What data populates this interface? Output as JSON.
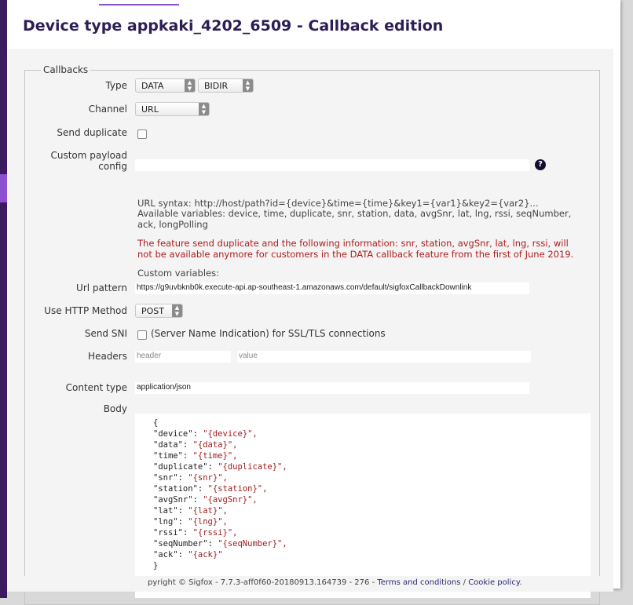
{
  "page": {
    "title": "Device type appkaki_4202_6509 - Callback edition"
  },
  "callbacks": {
    "legend": "Callbacks",
    "type_label": "Type",
    "type_value": "DATA",
    "direction_value": "BIDIR",
    "channel_label": "Channel",
    "channel_value": "URL",
    "send_duplicate_label": "Send duplicate",
    "custom_payload_label": "Custom payload config",
    "url_syntax": "URL syntax: http://host/path?id={device}&time={time}&key1={var1}&key2={var2}...",
    "available_vars": "Available variables: device, time, duplicate, snr, station, data, avgSnr, lat, lng, rssi, seqNumber, ack, longPolling",
    "warning": "The feature send duplicate and the following information: snr, station, avgSnr, lat, lng, rssi, will not be available anymore for customers in the DATA callback feature from the first of June 2019.",
    "custom_vars_label": "Custom variables:",
    "url_pattern_label": "Url pattern",
    "url_pattern_value": "https://g9uvbknb0k.execute-api.ap-southeast-1.amazonaws.com/default/sigfoxCallbackDownlink",
    "http_method_label": "Use HTTP Method",
    "http_method_value": "POST",
    "send_sni_label": "Send SNI",
    "send_sni_text": "(Server Name Indication) for SSL/TLS connections",
    "headers_label": "Headers",
    "header_placeholder": "header",
    "value_placeholder": "value",
    "content_type_label": "Content type",
    "content_type_value": "application/json",
    "body_label": "Body",
    "body_lines": [
      [
        "{",
        ""
      ],
      [
        "\"device\": ",
        "\"{device}\","
      ],
      [
        "\"data\": ",
        "\"{data}\","
      ],
      [
        "\"time\": ",
        "\"{time}\","
      ],
      [
        "\"duplicate\": ",
        "\"{duplicate}\","
      ],
      [
        "\"snr\": ",
        "\"{snr}\","
      ],
      [
        "\"station\": ",
        "\"{station}\","
      ],
      [
        "\"avgSnr\": ",
        "\"{avgSnr}\","
      ],
      [
        "\"lat\": ",
        "\"{lat}\","
      ],
      [
        "\"lng\": ",
        "\"{lng}\","
      ],
      [
        "\"rssi\": ",
        "\"{rssi}\","
      ],
      [
        "\"seqNumber\": ",
        "\"{seqNumber}\","
      ],
      [
        "\"ack\": ",
        "\"{ack}\""
      ],
      [
        "}",
        ""
      ]
    ]
  },
  "footer": {
    "copyright": "pyright © Sigfox - 7.7.3-aff0f60-20180913.164739 - 276 - ",
    "terms": "Terms and conditions",
    "separator": " / ",
    "cookie": "Cookie policy",
    "end": "."
  },
  "icons": {
    "help": "question-circle-icon",
    "select_arrows": "up-down-arrows-icon"
  },
  "colors": {
    "title": "#2c1d56",
    "sidebar": "#3b1b5e",
    "accent": "#8c4fcf",
    "warning": "#b01c1c"
  }
}
